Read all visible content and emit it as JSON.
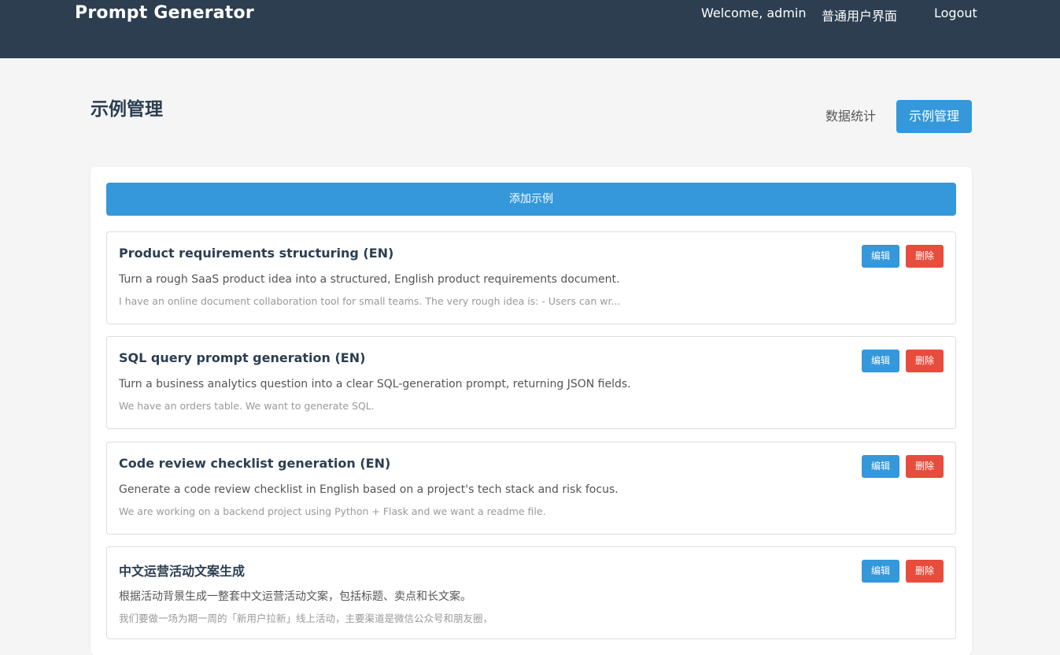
{
  "header": {
    "brand": "Prompt Generator",
    "welcome": "Welcome, admin",
    "user_interface": "普通用户界面",
    "logout": "Logout"
  },
  "page": {
    "title": "示例管理",
    "tabs": [
      {
        "label": "数据统计",
        "active": false
      },
      {
        "label": "示例管理",
        "active": true
      }
    ]
  },
  "panel": {
    "add_label": "添加示例",
    "edit_label": "编辑",
    "delete_label": "删除",
    "examples": [
      {
        "title": "Product requirements structuring (EN)",
        "description": "Turn a rough SaaS product idea into a structured, English product requirements document.",
        "preview": "I have an online document collaboration tool for small teams. The very rough idea is: - Users can wr..."
      },
      {
        "title": "SQL query prompt generation (EN)",
        "description": "Turn a business analytics question into a clear SQL-generation prompt, returning JSON fields.",
        "preview": "We have an orders table. We want to generate SQL."
      },
      {
        "title": "Code review checklist generation (EN)",
        "description": "Generate a code review checklist in English based on a project's tech stack and risk focus.",
        "preview": "We are working on a backend project using Python + Flask and we want a readme file."
      },
      {
        "title": "中文运营活动文案生成",
        "description": "根据活动背景生成一整套中文运营活动文案，包括标题、卖点和长文案。",
        "preview": "我们要做一场为期一周的「新用户拉新」线上活动，主要渠道是微信公众号和朋友圈，"
      }
    ]
  },
  "colors": {
    "navbar": "#2c3e50",
    "primary": "#3498db",
    "danger": "#e74c3c",
    "background": "#f5f5f5"
  }
}
